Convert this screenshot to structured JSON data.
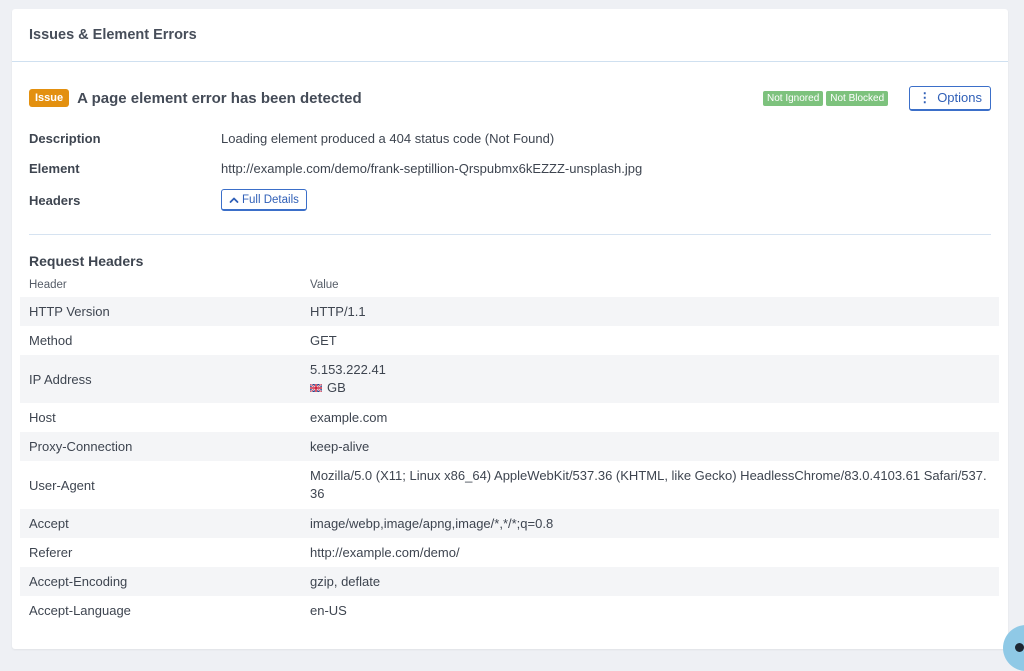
{
  "card": {
    "title": "Issues & Element Errors"
  },
  "issue": {
    "badge": "Issue",
    "title": "A page element error has been detected",
    "statuses": [
      "Not Ignored",
      "Not Blocked"
    ],
    "options_label": "Options",
    "options_icon": "kebab-vertical-icon"
  },
  "details": {
    "description_label": "Description",
    "description_value": "Loading element produced a 404 status code (Not Found)",
    "element_label": "Element",
    "element_value": "http://example.com/demo/frank-septillion-Qrspubmx6kEZZZ-unsplash.jpg",
    "headers_label": "Headers",
    "full_details_label": "Full Details",
    "full_details_icon": "chevron-up-icon"
  },
  "request_headers": {
    "title": "Request Headers",
    "columns": [
      "Header",
      "Value"
    ],
    "rows": [
      {
        "name": "HTTP Version",
        "value": "HTTP/1.1"
      },
      {
        "name": "Method",
        "value": "GET"
      },
      {
        "name": "IP Address",
        "value": "5.153.222.41",
        "sub": "GB",
        "sub_icon": "uk-flag-icon"
      },
      {
        "name": "Host",
        "value": "example.com"
      },
      {
        "name": "Proxy-Connection",
        "value": "keep-alive"
      },
      {
        "name": "User-Agent",
        "value": "Mozilla/5.0 (X11; Linux x86_64) AppleWebKit/537.36 (KHTML, like Gecko) HeadlessChrome/83.0.4103.61 Safari/537.36"
      },
      {
        "name": "Accept",
        "value": "image/webp,image/apng,image/*,*/*;q=0.8"
      },
      {
        "name": "Referer",
        "value": "http://example.com/demo/"
      },
      {
        "name": "Accept-Encoding",
        "value": "gzip, deflate"
      },
      {
        "name": "Accept-Language",
        "value": "en-US"
      }
    ]
  },
  "colors": {
    "issue_badge": "#e3900f",
    "status_badge": "#7dc27d",
    "button_accent": "#3b6fc9",
    "stripe": "#f4f5f7"
  }
}
